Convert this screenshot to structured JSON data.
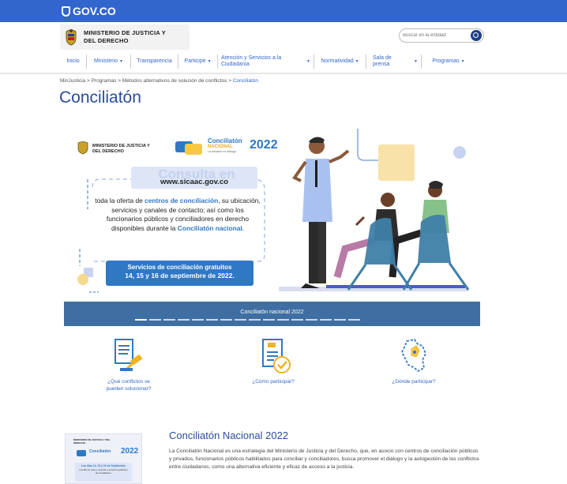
{
  "gov_bar": {
    "logo": "GOV.CO"
  },
  "header": {
    "ministry_line1": "MINISTERIO DE JUSTICIA Y",
    "ministry_line2": "DEL DERECHO",
    "search_placeholder": "Buscar en la entidad"
  },
  "nav": {
    "items": [
      {
        "label": "Inicio",
        "dropdown": false
      },
      {
        "label": "Ministerio",
        "dropdown": true
      },
      {
        "label": "Transparencia",
        "dropdown": false
      },
      {
        "label": "Participe",
        "dropdown": true
      },
      {
        "label": "Atención y Servicios a la Ciudadanía",
        "dropdown": true
      },
      {
        "label": "Normatividad",
        "dropdown": true
      },
      {
        "label": "Sala de prensa",
        "dropdown": true
      },
      {
        "label": "Programas",
        "dropdown": true
      }
    ]
  },
  "breadcrumb": {
    "items": [
      "MinJusticia",
      "Programas",
      "Métodos alternativos de solución de conflictos"
    ],
    "current": "Conciliatón",
    "separator": ">"
  },
  "page": {
    "title": "Conciliatón"
  },
  "banner": {
    "ministry_line1": "MINISTERIO DE JUSTICIA Y",
    "ministry_line2": "DEL DERECHO",
    "event_name_1": "Conciliatón",
    "event_name_2": "NACIONAL",
    "event_tagline": "La solución en diálogo",
    "event_year": "2022",
    "heading": "Consulta en",
    "url": "www.sicaac.gov.co",
    "body_1": "toda la oferta de ",
    "body_bold_1": "centros de conciliación",
    "body_2": ", su ubicación, servicios y canales de contacto; así como los funcionarios públicos y  conciliadores en derecho disponibles durante la ",
    "body_bold_2": "Conciliatón nacional.",
    "cta_line1": "Servicios de conciliación gratuitos",
    "cta_line2": "14, 15 y 16 de septiembre de 2022.",
    "caption": "Conciliatón nacional 2022",
    "slide_count": 16,
    "active_slide": 1
  },
  "features": [
    {
      "label_1": "¿Qué conflictos se",
      "label_2": "pueden solucionar?",
      "icon": "gavel-document-icon"
    },
    {
      "label_1": "¿Cómo participar?",
      "label_2": "",
      "icon": "document-check-icon"
    },
    {
      "label_1": "¿Dónde participar?",
      "label_2": "",
      "icon": "colombia-map-icon"
    }
  ],
  "news": {
    "title": "Conciliatón Nacional 2022",
    "body": "La Conciliatón Nacional es una estrategia del Ministerio de Justicia y del Derecho, que, en asocio con centros de conciliación públicos y privados, funcionarios públicos habilitados para conciliar y conciliadores, busca promover el diálogo y la autogestión de los conflictos entre ciudadanos, como una alternativa eficiente y eficaz de acceso a la justicia.",
    "thumb_ministry": "MINISTERIO DE JUSTICIA Y DEL DERECHO",
    "thumb_event": "Conciliatón",
    "thumb_year": "2022",
    "thumb_dates": "Los días 14, 15 y 16 de Septiembre",
    "thumb_desc": "Inscribe tu caso y accede a servicios gratuitos de conciliación."
  },
  "colors": {
    "gov_blue": "#3366cc",
    "title_blue": "#2a4c9a",
    "banner_caption": "#3f6ea2",
    "accent_yellow": "#f6c945",
    "cta_blue": "#2f78c4"
  }
}
